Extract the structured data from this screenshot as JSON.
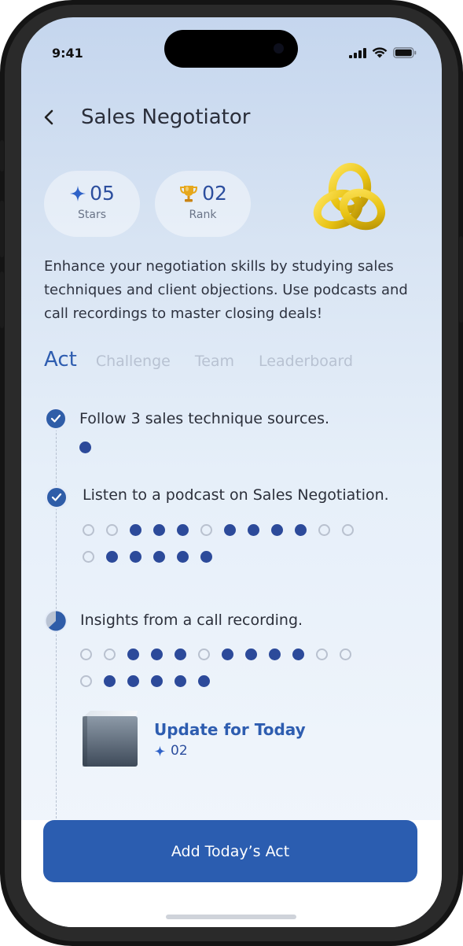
{
  "status_bar": {
    "time": "9:41"
  },
  "header": {
    "title": "Sales Negotiator"
  },
  "stats": [
    {
      "value": "05",
      "label": "Stars",
      "icon": "sparkle-icon"
    },
    {
      "value": "02",
      "label": "Rank",
      "icon": "trophy-icon"
    }
  ],
  "description": "Enhance your negotiation skills by studying sales techniques and client objections. Use podcasts and call recordings to master closing deals!",
  "tabs": [
    {
      "label": "Act",
      "active": true
    },
    {
      "label": "Challenge",
      "active": false
    },
    {
      "label": "Team",
      "active": false
    },
    {
      "label": "Leaderboard",
      "active": false
    }
  ],
  "tasks": [
    {
      "text": "Follow 3 sales technique sources.",
      "status": "done",
      "progress_rows": [
        [
          1
        ]
      ]
    },
    {
      "text": "Listen to a podcast on Sales Negotiation.",
      "status": "done",
      "progress_rows": [
        [
          0,
          0,
          1,
          1,
          1,
          0,
          1,
          1,
          1,
          1,
          0,
          0
        ],
        [
          0,
          1,
          1,
          1,
          1,
          1
        ]
      ]
    },
    {
      "text": "Insights from a call recording.",
      "status": "in-progress",
      "progress_rows": [
        [
          0,
          0,
          1,
          1,
          1,
          0,
          1,
          1,
          1,
          1,
          0,
          0
        ],
        [
          0,
          1,
          1,
          1,
          1,
          1
        ]
      ]
    }
  ],
  "update": {
    "title": "Update for Today",
    "stars": "02"
  },
  "cta": {
    "label": "Add Today’s Act"
  },
  "colors": {
    "accent": "#2b5db0",
    "dot_filled": "#2c4a9a",
    "trophy": "#e3a21a",
    "knot": "#f2cf1c"
  }
}
